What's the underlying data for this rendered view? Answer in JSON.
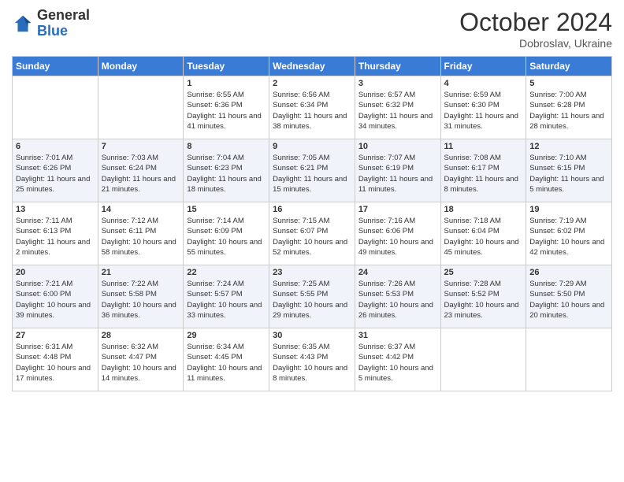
{
  "header": {
    "logo": {
      "line1": "General",
      "line2": "Blue"
    },
    "title": "October 2024",
    "subtitle": "Dobroslav, Ukraine"
  },
  "weekdays": [
    "Sunday",
    "Monday",
    "Tuesday",
    "Wednesday",
    "Thursday",
    "Friday",
    "Saturday"
  ],
  "weeks": [
    [
      {
        "day": "",
        "sunrise": "",
        "sunset": "",
        "daylight": ""
      },
      {
        "day": "",
        "sunrise": "",
        "sunset": "",
        "daylight": ""
      },
      {
        "day": "1",
        "sunrise": "Sunrise: 6:55 AM",
        "sunset": "Sunset: 6:36 PM",
        "daylight": "Daylight: 11 hours and 41 minutes."
      },
      {
        "day": "2",
        "sunrise": "Sunrise: 6:56 AM",
        "sunset": "Sunset: 6:34 PM",
        "daylight": "Daylight: 11 hours and 38 minutes."
      },
      {
        "day": "3",
        "sunrise": "Sunrise: 6:57 AM",
        "sunset": "Sunset: 6:32 PM",
        "daylight": "Daylight: 11 hours and 34 minutes."
      },
      {
        "day": "4",
        "sunrise": "Sunrise: 6:59 AM",
        "sunset": "Sunset: 6:30 PM",
        "daylight": "Daylight: 11 hours and 31 minutes."
      },
      {
        "day": "5",
        "sunrise": "Sunrise: 7:00 AM",
        "sunset": "Sunset: 6:28 PM",
        "daylight": "Daylight: 11 hours and 28 minutes."
      }
    ],
    [
      {
        "day": "6",
        "sunrise": "Sunrise: 7:01 AM",
        "sunset": "Sunset: 6:26 PM",
        "daylight": "Daylight: 11 hours and 25 minutes."
      },
      {
        "day": "7",
        "sunrise": "Sunrise: 7:03 AM",
        "sunset": "Sunset: 6:24 PM",
        "daylight": "Daylight: 11 hours and 21 minutes."
      },
      {
        "day": "8",
        "sunrise": "Sunrise: 7:04 AM",
        "sunset": "Sunset: 6:23 PM",
        "daylight": "Daylight: 11 hours and 18 minutes."
      },
      {
        "day": "9",
        "sunrise": "Sunrise: 7:05 AM",
        "sunset": "Sunset: 6:21 PM",
        "daylight": "Daylight: 11 hours and 15 minutes."
      },
      {
        "day": "10",
        "sunrise": "Sunrise: 7:07 AM",
        "sunset": "Sunset: 6:19 PM",
        "daylight": "Daylight: 11 hours and 11 minutes."
      },
      {
        "day": "11",
        "sunrise": "Sunrise: 7:08 AM",
        "sunset": "Sunset: 6:17 PM",
        "daylight": "Daylight: 11 hours and 8 minutes."
      },
      {
        "day": "12",
        "sunrise": "Sunrise: 7:10 AM",
        "sunset": "Sunset: 6:15 PM",
        "daylight": "Daylight: 11 hours and 5 minutes."
      }
    ],
    [
      {
        "day": "13",
        "sunrise": "Sunrise: 7:11 AM",
        "sunset": "Sunset: 6:13 PM",
        "daylight": "Daylight: 11 hours and 2 minutes."
      },
      {
        "day": "14",
        "sunrise": "Sunrise: 7:12 AM",
        "sunset": "Sunset: 6:11 PM",
        "daylight": "Daylight: 10 hours and 58 minutes."
      },
      {
        "day": "15",
        "sunrise": "Sunrise: 7:14 AM",
        "sunset": "Sunset: 6:09 PM",
        "daylight": "Daylight: 10 hours and 55 minutes."
      },
      {
        "day": "16",
        "sunrise": "Sunrise: 7:15 AM",
        "sunset": "Sunset: 6:07 PM",
        "daylight": "Daylight: 10 hours and 52 minutes."
      },
      {
        "day": "17",
        "sunrise": "Sunrise: 7:16 AM",
        "sunset": "Sunset: 6:06 PM",
        "daylight": "Daylight: 10 hours and 49 minutes."
      },
      {
        "day": "18",
        "sunrise": "Sunrise: 7:18 AM",
        "sunset": "Sunset: 6:04 PM",
        "daylight": "Daylight: 10 hours and 45 minutes."
      },
      {
        "day": "19",
        "sunrise": "Sunrise: 7:19 AM",
        "sunset": "Sunset: 6:02 PM",
        "daylight": "Daylight: 10 hours and 42 minutes."
      }
    ],
    [
      {
        "day": "20",
        "sunrise": "Sunrise: 7:21 AM",
        "sunset": "Sunset: 6:00 PM",
        "daylight": "Daylight: 10 hours and 39 minutes."
      },
      {
        "day": "21",
        "sunrise": "Sunrise: 7:22 AM",
        "sunset": "Sunset: 5:58 PM",
        "daylight": "Daylight: 10 hours and 36 minutes."
      },
      {
        "day": "22",
        "sunrise": "Sunrise: 7:24 AM",
        "sunset": "Sunset: 5:57 PM",
        "daylight": "Daylight: 10 hours and 33 minutes."
      },
      {
        "day": "23",
        "sunrise": "Sunrise: 7:25 AM",
        "sunset": "Sunset: 5:55 PM",
        "daylight": "Daylight: 10 hours and 29 minutes."
      },
      {
        "day": "24",
        "sunrise": "Sunrise: 7:26 AM",
        "sunset": "Sunset: 5:53 PM",
        "daylight": "Daylight: 10 hours and 26 minutes."
      },
      {
        "day": "25",
        "sunrise": "Sunrise: 7:28 AM",
        "sunset": "Sunset: 5:52 PM",
        "daylight": "Daylight: 10 hours and 23 minutes."
      },
      {
        "day": "26",
        "sunrise": "Sunrise: 7:29 AM",
        "sunset": "Sunset: 5:50 PM",
        "daylight": "Daylight: 10 hours and 20 minutes."
      }
    ],
    [
      {
        "day": "27",
        "sunrise": "Sunrise: 6:31 AM",
        "sunset": "Sunset: 4:48 PM",
        "daylight": "Daylight: 10 hours and 17 minutes."
      },
      {
        "day": "28",
        "sunrise": "Sunrise: 6:32 AM",
        "sunset": "Sunset: 4:47 PM",
        "daylight": "Daylight: 10 hours and 14 minutes."
      },
      {
        "day": "29",
        "sunrise": "Sunrise: 6:34 AM",
        "sunset": "Sunset: 4:45 PM",
        "daylight": "Daylight: 10 hours and 11 minutes."
      },
      {
        "day": "30",
        "sunrise": "Sunrise: 6:35 AM",
        "sunset": "Sunset: 4:43 PM",
        "daylight": "Daylight: 10 hours and 8 minutes."
      },
      {
        "day": "31",
        "sunrise": "Sunrise: 6:37 AM",
        "sunset": "Sunset: 4:42 PM",
        "daylight": "Daylight: 10 hours and 5 minutes."
      },
      {
        "day": "",
        "sunrise": "",
        "sunset": "",
        "daylight": ""
      },
      {
        "day": "",
        "sunrise": "",
        "sunset": "",
        "daylight": ""
      }
    ]
  ]
}
